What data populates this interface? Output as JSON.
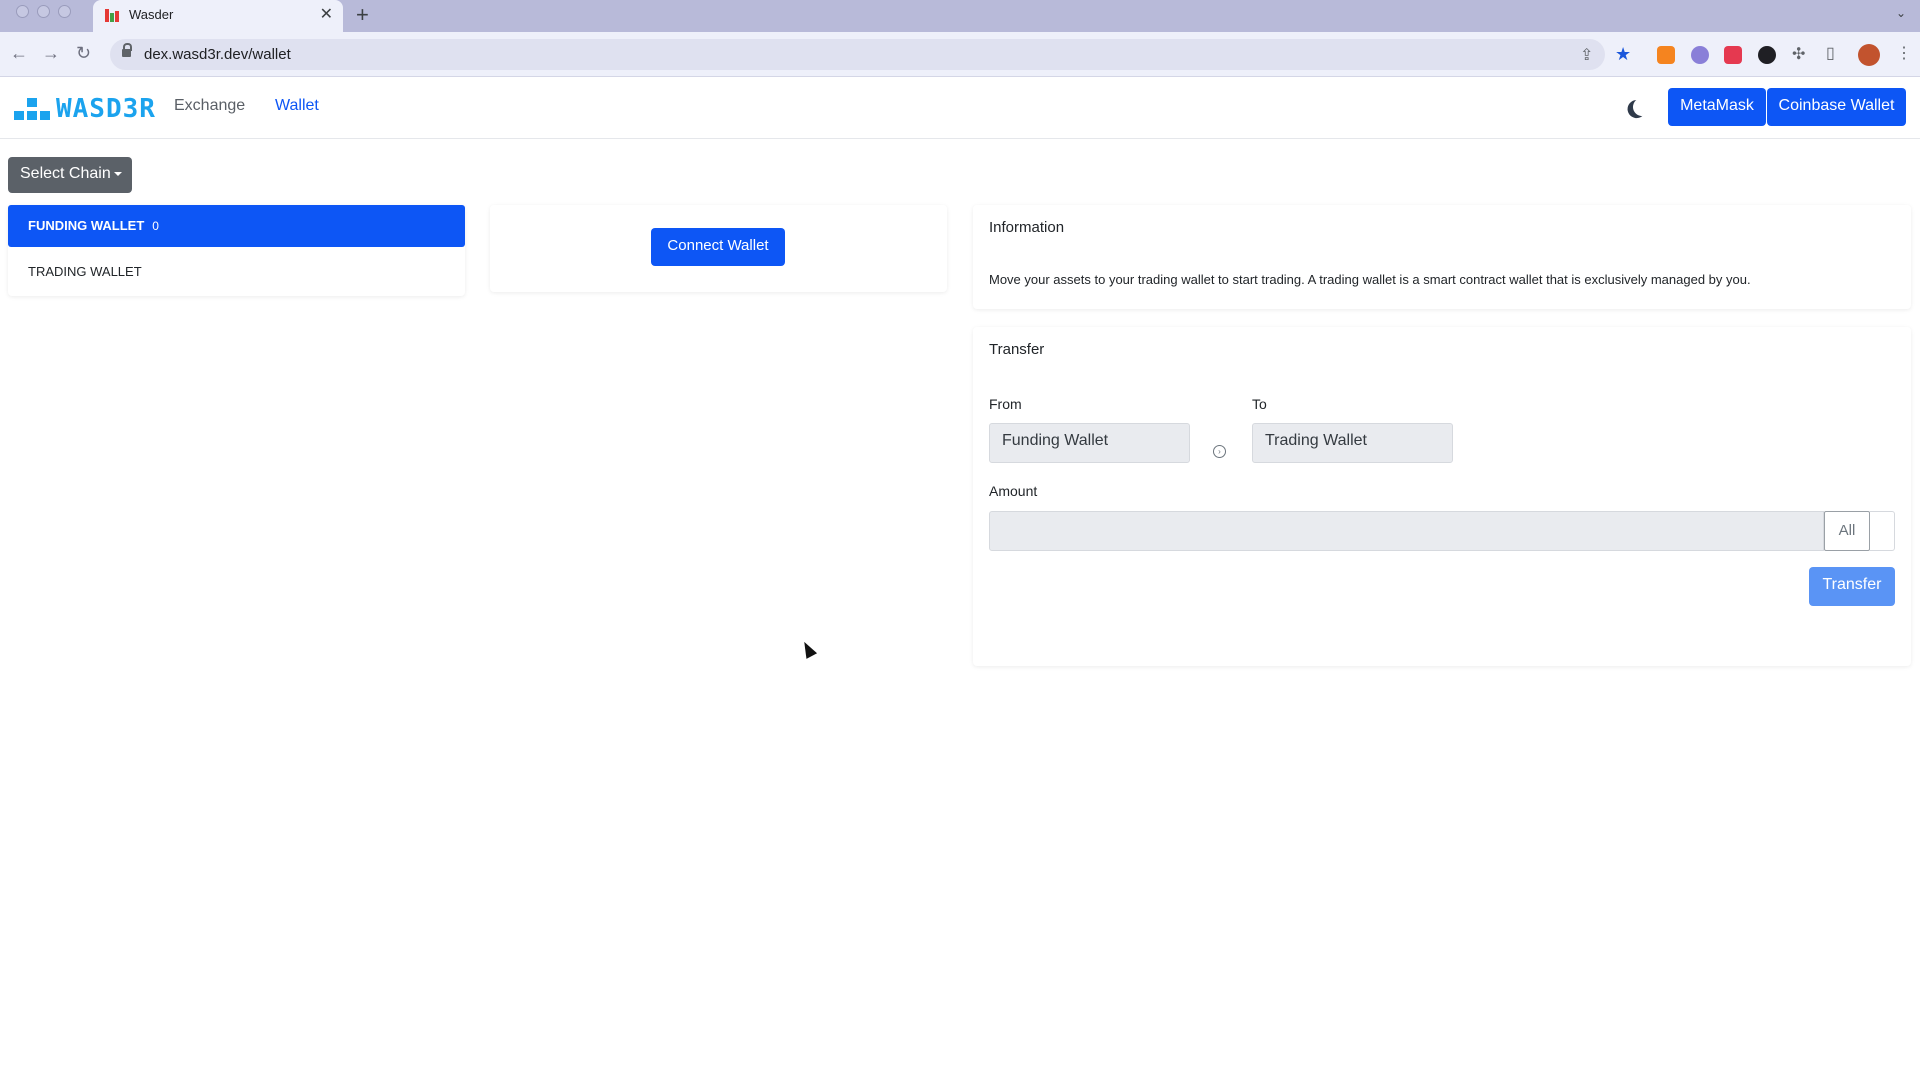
{
  "browser": {
    "tab_title": "Wasder",
    "new_tab_symbol": "+",
    "close_symbol": "✕",
    "tab_menu_symbol": "⌄",
    "url": "dex.wasd3r.dev/wallet",
    "back_symbol": "←",
    "forward_symbol": "→",
    "reload_symbol": "↻",
    "share_symbol": "⇪",
    "bookmark_symbol": "★",
    "menu_symbol": "⋮",
    "puzzle_symbol": "✣",
    "sidepanel_symbol": "▯"
  },
  "header": {
    "logo_text": "WASD3R",
    "nav": [
      {
        "label": "Exchange",
        "active": false
      },
      {
        "label": "Wallet",
        "active": true
      }
    ],
    "metamask_label": "MetaMask",
    "coinbase_label": "Coinbase Wallet"
  },
  "chain_selector": {
    "label": "Select Chain"
  },
  "wallets": {
    "items": [
      {
        "label": "FUNDING WALLET",
        "count": "0",
        "active": true
      },
      {
        "label": "TRADING WALLET",
        "count": "",
        "active": false
      }
    ]
  },
  "connect": {
    "button_label": "Connect Wallet"
  },
  "information": {
    "title": "Information",
    "text": "Move your assets to your trading wallet to start trading. A trading wallet is a smart contract wallet that is exclusively managed by you."
  },
  "transfer": {
    "title": "Transfer",
    "from_label": "From",
    "from_value": "Funding Wallet",
    "to_label": "To",
    "to_value": "Trading Wallet",
    "swap_symbol": "›",
    "amount_label": "Amount",
    "amount_value": "",
    "all_label": "All",
    "submit_label": "Transfer"
  },
  "colors": {
    "accent": "#0d56f5",
    "logo": "#1ba3ee",
    "transfer_button_disabled": "#5a94f5"
  }
}
